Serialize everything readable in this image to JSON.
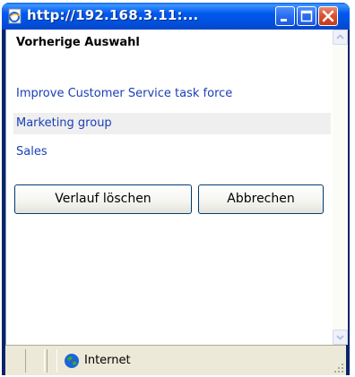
{
  "window": {
    "title": "http://192.168.3.11:..."
  },
  "history": {
    "heading": "Vorherige Auswahl",
    "items": [
      {
        "label": "Improve Customer Service task force",
        "selected": false
      },
      {
        "label": "Marketing group",
        "selected": true
      },
      {
        "label": "Sales",
        "selected": false
      }
    ]
  },
  "buttons": {
    "clear_label": "Verlauf löschen",
    "cancel_label": "Abbrechen"
  },
  "statusbar": {
    "zone_label": "Internet",
    "zone_icon": "globe-icon"
  },
  "colors": {
    "titlebar": "#0058ee",
    "link": "#1a3fb8",
    "selected_row": "#efefef",
    "close_button": "#d8502e"
  }
}
